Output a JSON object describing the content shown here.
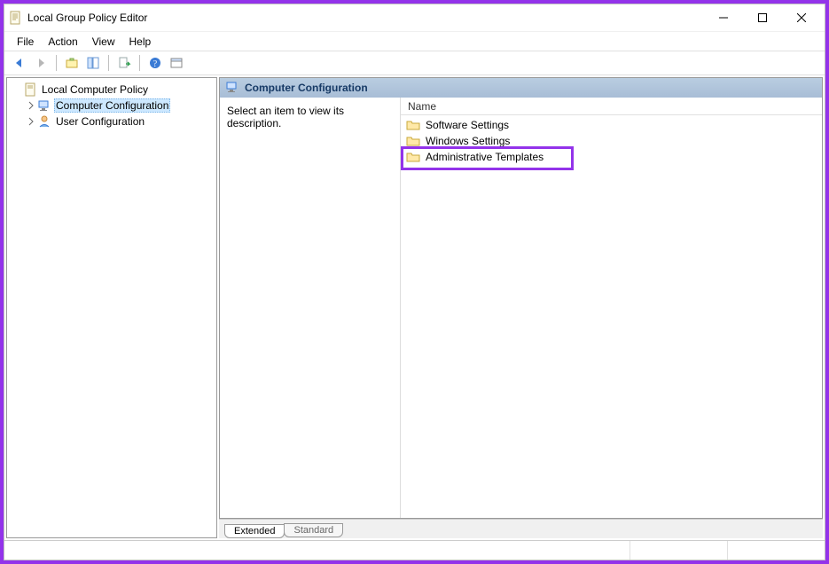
{
  "window": {
    "title": "Local Group Policy Editor"
  },
  "menubar": {
    "file": "File",
    "action": "Action",
    "view": "View",
    "help": "Help"
  },
  "tree": {
    "root_label": "Local Computer Policy",
    "computer_label": "Computer Configuration",
    "user_label": "User Configuration"
  },
  "detail": {
    "header": "Computer Configuration",
    "empty_prompt": "Select an item to view its description.",
    "column_name": "Name",
    "items": [
      {
        "label": "Software Settings"
      },
      {
        "label": "Windows Settings"
      },
      {
        "label": "Administrative Templates"
      }
    ]
  },
  "tabs": {
    "extended": "Extended",
    "standard": "Standard"
  }
}
